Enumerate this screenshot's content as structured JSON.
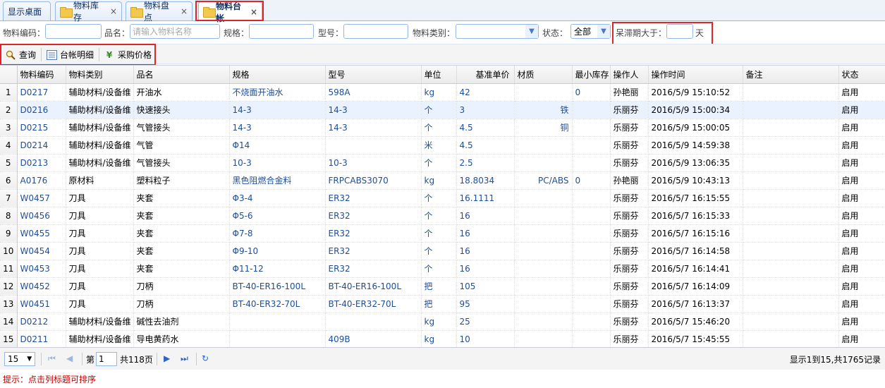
{
  "tabs": [
    {
      "label": "显示桌面",
      "icon": "none",
      "closable": false
    },
    {
      "label": "物料库存",
      "icon": "folder-icon",
      "closable": true
    },
    {
      "label": "物料盘点",
      "icon": "folder-icon",
      "closable": true
    },
    {
      "label": "物料台帐",
      "icon": "folder-icon",
      "closable": true,
      "active": true
    }
  ],
  "search": {
    "code_label": "物料编码：",
    "code_value": "",
    "name_label": "品名：",
    "name_placeholder": "请输入物料名称",
    "spec_label": "规格：",
    "model_label": "型号：",
    "category_label": "物料类别：",
    "category_value": "",
    "status_label": "状态：",
    "status_value": "全部",
    "stagnant_label": "呆滞期大于：",
    "stagnant_value": "",
    "stagnant_unit": "天"
  },
  "toolbar": {
    "query_label": "查询",
    "ledger_detail_label": "台帐明细",
    "purchase_price_label": "采购价格"
  },
  "grid": {
    "columns": [
      "物料编码",
      "物料类别",
      "品名",
      "规格",
      "型号",
      "单位",
      "基准单价",
      "材质",
      "最小库存",
      "操作人",
      "操作时间",
      "备注",
      "状态"
    ],
    "rows": [
      [
        "1",
        "D0217",
        "辅助材料/设备维",
        "开油水",
        "不烧面开油水",
        "598A",
        "kg",
        "42",
        "",
        "0",
        "孙艳丽",
        "2016/5/9 15:10:52",
        "",
        "启用"
      ],
      [
        "2",
        "D0216",
        "辅助材料/设备维",
        "快速接头",
        "14-3",
        "14-3",
        "个",
        "3",
        "铁",
        "",
        "乐丽芬",
        "2016/5/9 15:00:34",
        "",
        "启用"
      ],
      [
        "3",
        "D0215",
        "辅助材料/设备维",
        "气管接头",
        "14-3",
        "14-3",
        "个",
        "4.5",
        "铜",
        "",
        "乐丽芬",
        "2016/5/9 15:00:05",
        "",
        "启用"
      ],
      [
        "4",
        "D0214",
        "辅助材料/设备维",
        "气管",
        "Φ14",
        "",
        "米",
        "4.5",
        "",
        "",
        "乐丽芬",
        "2016/5/9 14:59:38",
        "",
        "启用"
      ],
      [
        "5",
        "D0213",
        "辅助材料/设备维",
        "气管接头",
        "10-3",
        "10-3",
        "个",
        "2.5",
        "",
        "",
        "乐丽芬",
        "2016/5/9 13:06:35",
        "",
        "启用"
      ],
      [
        "6",
        "A0176",
        "原材料",
        "塑料粒子",
        "黑色阻燃合金料",
        "FRPCABS3070",
        "kg",
        "18.8034",
        "PC/ABS",
        "0",
        "孙艳丽",
        "2016/5/9 10:43:13",
        "",
        "启用"
      ],
      [
        "7",
        "W0457",
        "刀具",
        "夹套",
        "Φ3-4",
        "ER32",
        "个",
        "16.1111",
        "",
        "",
        "乐丽芬",
        "2016/5/7 16:15:55",
        "",
        "启用"
      ],
      [
        "8",
        "W0456",
        "刀具",
        "夹套",
        "Φ5-6",
        "ER32",
        "个",
        "16",
        "",
        "",
        "乐丽芬",
        "2016/5/7 16:15:33",
        "",
        "启用"
      ],
      [
        "9",
        "W0455",
        "刀具",
        "夹套",
        "Φ7-8",
        "ER32",
        "个",
        "16",
        "",
        "",
        "乐丽芬",
        "2016/5/7 16:15:16",
        "",
        "启用"
      ],
      [
        "10",
        "W0454",
        "刀具",
        "夹套",
        "Φ9-10",
        "ER32",
        "个",
        "16",
        "",
        "",
        "乐丽芬",
        "2016/5/7 16:14:58",
        "",
        "启用"
      ],
      [
        "11",
        "W0453",
        "刀具",
        "夹套",
        "Φ11-12",
        "ER32",
        "个",
        "16",
        "",
        "",
        "乐丽芬",
        "2016/5/7 16:14:41",
        "",
        "启用"
      ],
      [
        "12",
        "W0452",
        "刀具",
        "刀柄",
        "BT-40-ER16-100L",
        "BT-40-ER16-100L",
        "把",
        "105",
        "",
        "",
        "乐丽芬",
        "2016/5/7 16:14:09",
        "",
        "启用"
      ],
      [
        "13",
        "W0451",
        "刀具",
        "刀柄",
        "BT-40-ER32-70L",
        "BT-40-ER32-70L",
        "把",
        "95",
        "",
        "",
        "乐丽芬",
        "2016/5/7 16:13:37",
        "",
        "启用"
      ],
      [
        "14",
        "D0212",
        "辅助材料/设备维",
        "碱性去油剂",
        "",
        "",
        "kg",
        "25",
        "",
        "",
        "乐丽芬",
        "2016/5/7 15:46:20",
        "",
        "启用"
      ],
      [
        "15",
        "D0211",
        "辅助材料/设备维",
        "导电黄药水",
        "",
        "409B",
        "kg",
        "10",
        "",
        "",
        "乐丽芬",
        "2016/5/7 15:45:55",
        "",
        "启用"
      ]
    ],
    "selected_row": 2
  },
  "pager": {
    "page_size": "15",
    "page_prefix": "第",
    "page_value": "1",
    "page_total": "共118页",
    "summary": "显示1到15,共1765记录"
  },
  "hint": "提示：点击列标题可排序",
  "colors": {
    "accent": "#95b8e7",
    "highlight_box": "#e0242b",
    "link_blue": "#1f4e99",
    "hint_red": "#c00000"
  }
}
